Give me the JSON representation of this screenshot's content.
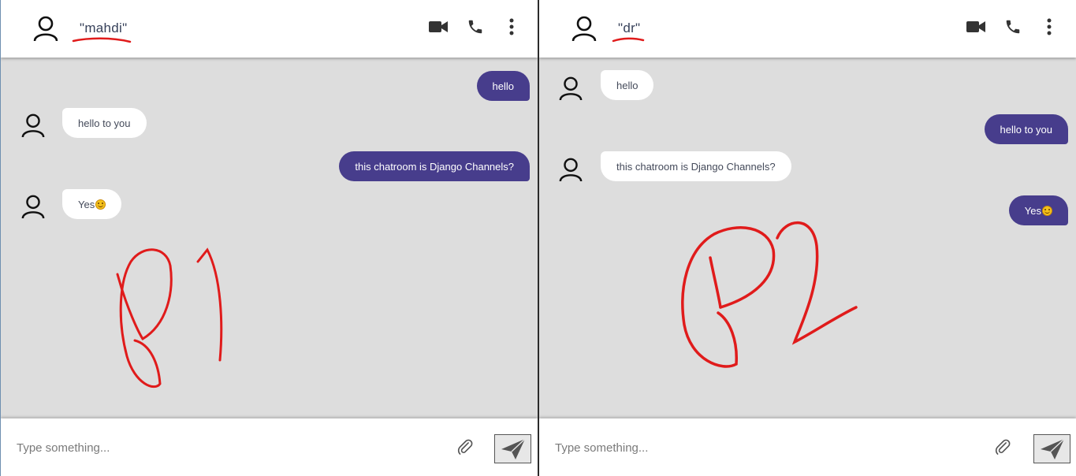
{
  "left_pane": {
    "contact_name": "\"mahdi\"",
    "messages": [
      {
        "side": "out",
        "text": "hello"
      },
      {
        "side": "in",
        "text": "hello to you"
      },
      {
        "side": "out",
        "text": "this chatroom is Django Channels?"
      },
      {
        "side": "in",
        "text": "Yes",
        "emoji": "slightly-smiling-face"
      }
    ],
    "annotation": "P1",
    "composer": {
      "placeholder": "Type something..."
    }
  },
  "right_pane": {
    "contact_name": "\"dr\"",
    "messages": [
      {
        "side": "in",
        "text": "hello"
      },
      {
        "side": "out",
        "text": "hello to you"
      },
      {
        "side": "in",
        "text": "this chatroom is Django Channels?"
      },
      {
        "side": "out",
        "text": "Yes",
        "emoji": "slightly-smiling-face"
      }
    ],
    "annotation": "P2",
    "composer": {
      "placeholder": "Type something..."
    }
  },
  "icons": {
    "video": "video-camera-icon",
    "call": "phone-icon",
    "menu": "more-vertical-icon",
    "attach": "paperclip-icon",
    "send": "send-icon",
    "avatar": "user-icon"
  },
  "colors": {
    "outgoing_bubble": "#473d8c",
    "incoming_bubble": "#ffffff",
    "chat_background": "#dddddd",
    "annotation_red": "#e01b1b"
  }
}
